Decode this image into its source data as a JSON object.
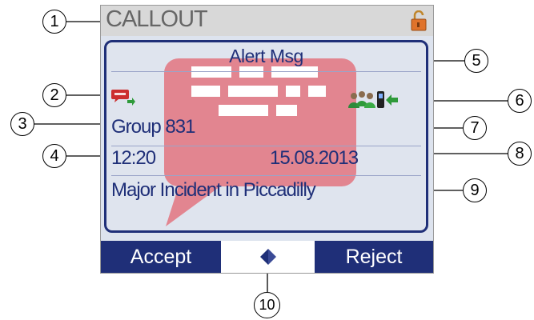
{
  "screen": {
    "title": "CALLOUT",
    "lock_icon": "padlock-open-icon",
    "alert_title": "Alert Msg",
    "group": "Group 831",
    "time": "12:20",
    "date": "15.08.2013",
    "message": "Major Incident in Piccadilly",
    "softkeys": {
      "left": "Accept",
      "right": "Reject",
      "nav_icon": "left-right-nav-icon"
    },
    "icons": {
      "message_status": "message-status-icon",
      "group_call": "group-call-icon"
    },
    "colors": {
      "accent": "#1f2f78",
      "bubble": "#e36a76",
      "status": "#cc2e2e",
      "green": "#2e9a3a"
    }
  },
  "callouts": [
    "1",
    "2",
    "3",
    "4",
    "5",
    "6",
    "7",
    "8",
    "9",
    "10"
  ]
}
